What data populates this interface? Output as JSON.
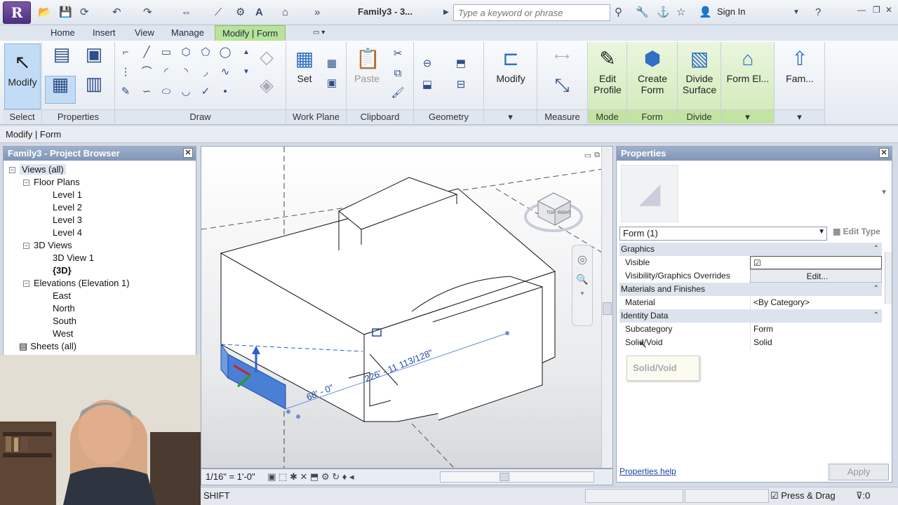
{
  "app": {
    "logo": "R",
    "doc_title": "Family3 - 3...",
    "search_placeholder": "Type a keyword or phrase",
    "signin_label": "Sign In"
  },
  "tabs": [
    {
      "label": "Home"
    },
    {
      "label": "Insert"
    },
    {
      "label": "View"
    },
    {
      "label": "Manage"
    },
    {
      "label": "Modify | Form",
      "active": true
    }
  ],
  "ribbon": {
    "panels": {
      "select": "Select",
      "properties": "Properties",
      "draw": "Draw",
      "work_plane": "Work Plane",
      "clipboard": "Clipboard",
      "geometry": "Geometry",
      "measure": "Measure",
      "mode": "Mode",
      "form": "Form",
      "divide": "Divide"
    },
    "buttons": {
      "modify": "Modify",
      "set": "Set",
      "paste": "Paste",
      "modify2": "Modify",
      "edit_profile_1": "Edit",
      "edit_profile_2": "Profile",
      "create_form_1": "Create",
      "create_form_2": "Form",
      "divide_surface_1": "Divide",
      "divide_surface_2": "Surface",
      "form_el": "Form El...",
      "fam": "Fam..."
    }
  },
  "options_bar": {
    "text": "Modify | Form"
  },
  "project_browser": {
    "title": "Family3 - Project Browser",
    "tree": [
      {
        "label": "Views (all)",
        "indent": 0,
        "toggle": "-"
      },
      {
        "label": "Floor Plans",
        "indent": 1,
        "toggle": "-"
      },
      {
        "label": "Level 1",
        "indent": 2
      },
      {
        "label": "Level 2",
        "indent": 2
      },
      {
        "label": "Level 3",
        "indent": 2
      },
      {
        "label": "Level 4",
        "indent": 2
      },
      {
        "label": "3D Views",
        "indent": 1,
        "toggle": "-"
      },
      {
        "label": "3D View 1",
        "indent": 2
      },
      {
        "label": "{3D}",
        "indent": 2,
        "bold": true
      },
      {
        "label": "Elevations (Elevation 1)",
        "indent": 1,
        "toggle": "-"
      },
      {
        "label": "East",
        "indent": 2
      },
      {
        "label": "North",
        "indent": 2
      },
      {
        "label": "South",
        "indent": 2
      },
      {
        "label": "West",
        "indent": 2
      },
      {
        "label": "Sheets (all)",
        "indent": 0
      }
    ]
  },
  "viewport": {
    "dim_1": "226' - 11 113/128\"",
    "dim_2": "68' - 0\"",
    "scale": "1/16\" = 1'-0\"",
    "viewcube_top": "TOP",
    "viewcube_right": "RIGHT"
  },
  "properties": {
    "title": "Properties",
    "type_selector": "Form (1)",
    "edit_type": "Edit Type",
    "groups": {
      "graphics": "Graphics",
      "materials": "Materials and Finishes",
      "identity": "Identity Data"
    },
    "rows": {
      "visible": {
        "name": "Visible",
        "value": "☑"
      },
      "vg_overrides": {
        "name": "Visibility/Graphics Overrides",
        "value": "Edit..."
      },
      "material": {
        "name": "Material",
        "value": "<By Category>"
      },
      "subcategory": {
        "name": "Subcategory",
        "value": "Form"
      },
      "solid_void": {
        "name": "Solid/Void",
        "value": "Solid"
      }
    },
    "tooltip": "Solid/Void",
    "help_link": "Properties help",
    "apply": "Apply"
  },
  "status": {
    "hint": "SHIFT",
    "press_drag": "Press & Drag",
    "filter_count": ":0"
  },
  "colors": {
    "accent": "#b7e39a",
    "pane_title": "#8a9fbf",
    "selection_face": "#4a7fd6"
  }
}
